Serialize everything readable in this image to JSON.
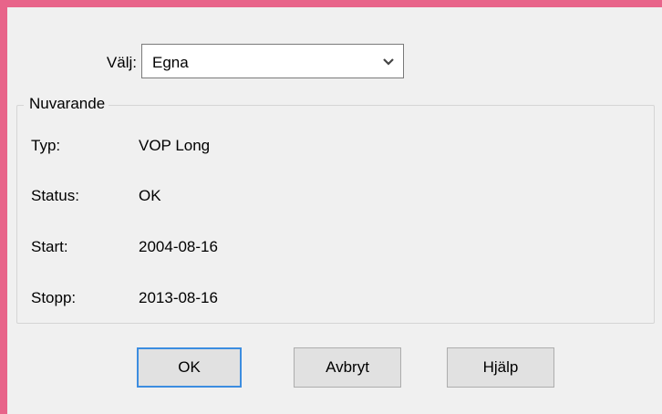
{
  "selector": {
    "label": "Välj:",
    "selected": "Egna",
    "arrow_icon": "chevron-down-icon"
  },
  "group": {
    "title": "Nuvarande",
    "fields": [
      {
        "label": "Typ:",
        "value": "VOP Long"
      },
      {
        "label": "Status:",
        "value": "OK"
      },
      {
        "label": "Start:",
        "value": "2004-08-16"
      },
      {
        "label": "Stopp:",
        "value": "2013-08-16"
      }
    ]
  },
  "buttons": {
    "ok": "OK",
    "cancel": "Avbryt",
    "help": "Hjälp"
  },
  "colors": {
    "window_frame": "#e8648a",
    "dialog_background": "#f0f0f0",
    "default_button_border": "#3c8de0"
  }
}
